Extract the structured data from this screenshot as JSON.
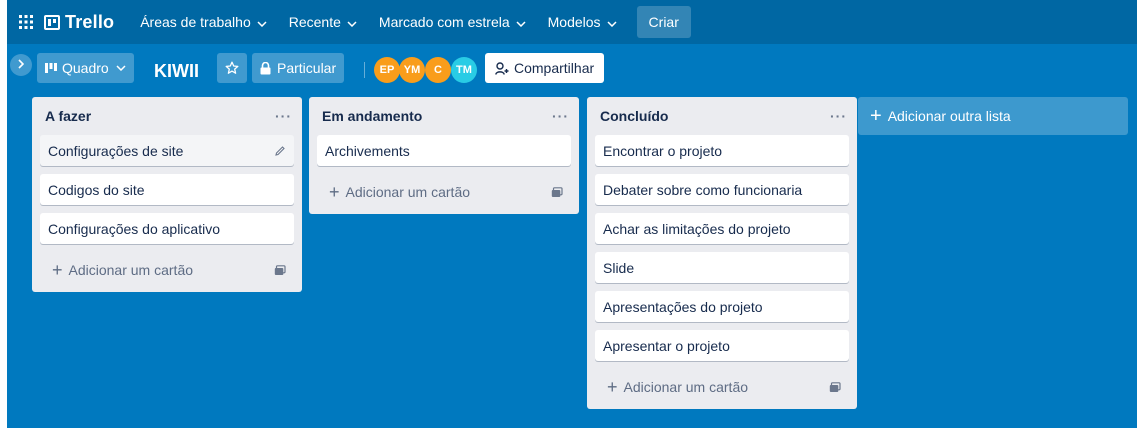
{
  "topbar": {
    "logo_text": "Trello",
    "nav": [
      {
        "label": "Áreas de trabalho"
      },
      {
        "label": "Recente"
      },
      {
        "label": "Marcado com estrela"
      },
      {
        "label": "Modelos"
      }
    ],
    "create_label": "Criar"
  },
  "board": {
    "view_label": "Quadro",
    "title": "KIWII",
    "visibility_label": "Particular",
    "members": [
      {
        "initials": "EP",
        "color": "#f99d1b"
      },
      {
        "initials": "YM",
        "color": "#f99d1b"
      },
      {
        "initials": "C",
        "color": "#f99d1b"
      },
      {
        "initials": "TM",
        "color": "#29cce5"
      }
    ],
    "share_label": "Compartilhar"
  },
  "lists": [
    {
      "title": "A fazer",
      "cards": [
        "Configurações de site",
        "Codigos do site",
        "Configurações do aplicativo"
      ],
      "add_card_label": "Adicionar um cartão"
    },
    {
      "title": "Em andamento",
      "cards": [
        "Archivements"
      ],
      "add_card_label": "Adicionar um cartão"
    },
    {
      "title": "Concluído",
      "cards": [
        "Encontrar o projeto",
        "Debater sobre como funcionaria",
        "Achar as limitações do projeto",
        "Slide",
        "Apresentações do projeto",
        "Apresentar o projeto"
      ],
      "add_card_label": "Adicionar um cartão"
    }
  ],
  "add_list_label": "Adicionar outra lista",
  "colors": {
    "board_bg": "#0079bf",
    "topbar_bg": "#0067a3",
    "list_bg": "#ebecf0"
  }
}
